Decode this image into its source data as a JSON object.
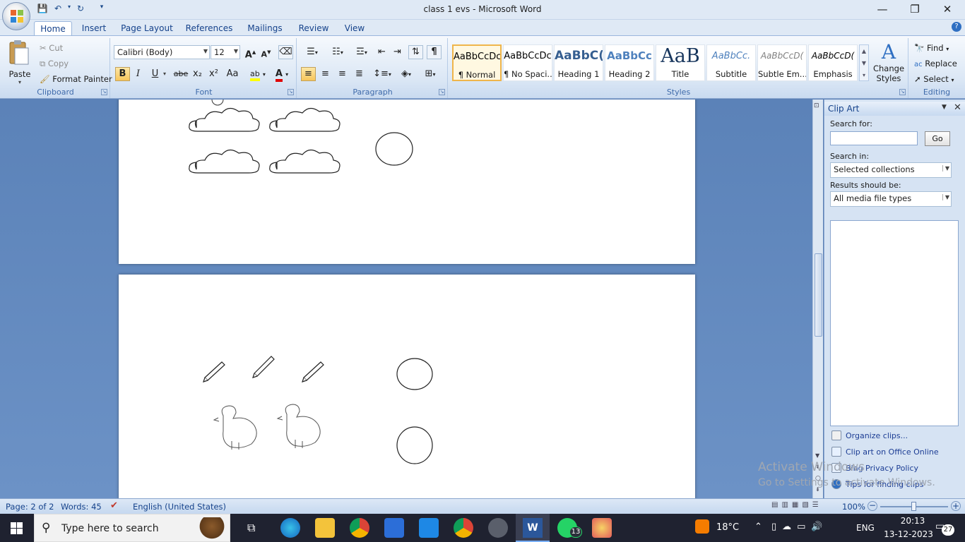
{
  "window": {
    "title": "class 1 evs - Microsoft Word",
    "minimize": "—",
    "restore": "❐",
    "close": "✕"
  },
  "tabs": [
    "Home",
    "Insert",
    "Page Layout",
    "References",
    "Mailings",
    "Review",
    "View"
  ],
  "clipboard": {
    "group": "Clipboard",
    "paste": "Paste",
    "cut": "Cut",
    "copy": "Copy",
    "format_painter": "Format Painter"
  },
  "font": {
    "group": "Font",
    "name": "Calibri (Body)",
    "size": "12",
    "grow": "A",
    "shrink": "A",
    "bold": "B",
    "italic": "I",
    "underline": "U",
    "strike": "abe",
    "sub": "x₂",
    "sup": "x²",
    "case": "Aa",
    "color_label": "A"
  },
  "paragraph": {
    "group": "Paragraph",
    "pilcrow": "¶"
  },
  "styles": {
    "group": "Styles",
    "items": [
      {
        "sample": "AaBbCcDc",
        "name": "¶ Normal"
      },
      {
        "sample": "AaBbCcDc",
        "name": "¶ No Spaci..."
      },
      {
        "sample": "AaBbC(",
        "name": "Heading 1"
      },
      {
        "sample": "AaBbCc",
        "name": "Heading 2"
      },
      {
        "sample": "AaB",
        "name": "Title"
      },
      {
        "sample": "AaBbCc.",
        "name": "Subtitle"
      },
      {
        "sample": "AaBbCcD(",
        "name": "Subtle Em..."
      },
      {
        "sample": "AaBbCcD(",
        "name": "Emphasis"
      }
    ],
    "change_styles_1": "Change",
    "change_styles_2": "Styles"
  },
  "editing": {
    "group": "Editing",
    "find": "Find",
    "replace": "Replace",
    "select": "Select"
  },
  "clip_art": {
    "title": "Clip Art",
    "search_for": "Search for:",
    "search_value": "",
    "go": "Go",
    "search_in": "Search in:",
    "search_in_value": "Selected collections",
    "results_be": "Results should be:",
    "results_value": "All media file types",
    "links": [
      "Organize clips...",
      "Clip art on Office Online",
      "Bing Privacy Policy",
      "Tips for finding clips"
    ]
  },
  "watermark": {
    "line1": "Activate Windows",
    "line2": "Go to Settings to activate Windows."
  },
  "status": {
    "page": "Page: 2 of 2",
    "words": "Words: 45",
    "language": "English (United States)",
    "zoom": "100%"
  },
  "taskbar": {
    "search_placeholder": "Type here to search",
    "weather": "18°C",
    "lang": "ENG",
    "time": "20:13",
    "date": "13-12-2023",
    "whatsapp_badge": "13",
    "notif_count": "27"
  }
}
